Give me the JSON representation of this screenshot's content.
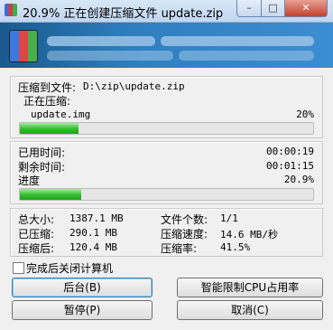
{
  "window": {
    "title": "20.9% 正在创建压缩文件 update.zip",
    "min_label": "–",
    "max_label": "□",
    "close_label": "✕"
  },
  "archive": {
    "compress_to_label": "压缩到文件:",
    "compress_to_path": "D:\\zip\\update.zip",
    "compressing_label": "正在压缩:",
    "current_file": "update.img",
    "current_percent_text": "20%",
    "current_progress": 0.2
  },
  "time": {
    "elapsed_label": "已用时间:",
    "elapsed_value": "00:00:19",
    "remaining_label": "剩余时间:",
    "remaining_value": "00:01:15",
    "progress_label": "进度",
    "progress_percent_text": "20.9%",
    "overall_progress": 0.209
  },
  "stats": {
    "total_size_label": "总大小:",
    "total_size_value": "1387.1 MB",
    "compressed_label": "已压缩:",
    "compressed_value": "290.1 MB",
    "after_label": "压缩后:",
    "after_value": "120.4 MB",
    "file_count_label": "文件个数:",
    "file_count_value": "1/1",
    "speed_label": "压缩速度:",
    "speed_value": "14.6 MB/秒",
    "ratio_label": "压缩率:",
    "ratio_value": "41.5%"
  },
  "options": {
    "shutdown_label": "完成后关闭计算机",
    "shutdown_checked": false
  },
  "buttons": {
    "background": "后台(B)",
    "limit_cpu": "智能限制CPU占用率",
    "pause": "暂停(P)",
    "cancel": "取消(C)"
  },
  "colors": {
    "progress_green": "#2fbd2c",
    "banner_blue": "#2e7fc0"
  }
}
